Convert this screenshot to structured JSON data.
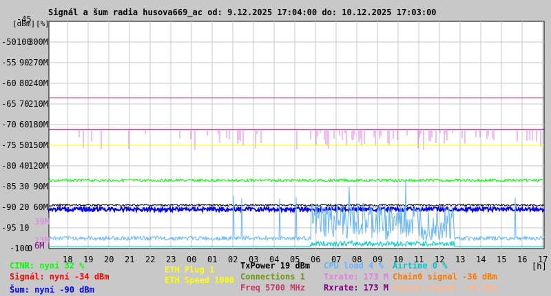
{
  "chart_data": {
    "type": "line",
    "title": "Signál a šum radia husova669_ac od: 9.12.2025 17:04:00 do: 10.12.2025 17:03:00",
    "ylabel_units": [
      "[dBm]",
      "[%]"
    ],
    "xlabel": "[h]",
    "x_ticks": [
      "18",
      "19",
      "20",
      "21",
      "22",
      "23",
      "00",
      "01",
      "02",
      "03",
      "04",
      "05",
      "06",
      "07",
      "08",
      "09",
      "10",
      "11",
      "12",
      "13",
      "14",
      "15",
      "16",
      "17"
    ],
    "y_ticks_dbm": [
      "-45",
      "-50",
      "-55",
      "-60",
      "-65",
      "-70",
      "-75",
      "-80",
      "-85",
      "-90",
      "-95",
      "-100"
    ],
    "y_ticks_pct": [
      "",
      "100",
      "90",
      "80",
      "70",
      "60",
      "50",
      "40",
      "30",
      "20",
      "10",
      "0"
    ],
    "y_ticks_rate": [
      "",
      "300M",
      "270M",
      "240M",
      "210M",
      "180M",
      "150M",
      "120M",
      "90M",
      "60M",
      "",
      ""
    ],
    "extra_rate_labels": [
      {
        "text": "39M",
        "color": "#e080e0"
      },
      {
        "text": "13M",
        "color": "#e080e0"
      },
      {
        "text": "6M",
        "color": "#800080"
      }
    ],
    "ylim_dbm": [
      -100,
      -45
    ],
    "grid": true,
    "series": [
      {
        "name": "Freq",
        "color": "#c83c64",
        "level_dbm": -63.5
      },
      {
        "name": "Rxrate",
        "color": "#800080",
        "level_dbm": -71.2
      },
      {
        "name": "Txrate",
        "color": "#e080e0",
        "level_dbm": -71.2
      },
      {
        "name": "ETH Speed",
        "color": "#ffff00",
        "level_dbm": -75
      },
      {
        "name": "CINR",
        "color": "#00ff00",
        "level_dbm": -83.5
      },
      {
        "name": "TxPower",
        "color": "#000000",
        "level_dbm": -89.5
      },
      {
        "name": "Šum",
        "color": "#0000ff",
        "level_dbm": -90.5
      },
      {
        "name": "CPU load",
        "color": "#64b4ff",
        "level_dbm": -98
      },
      {
        "name": "Airtime",
        "color": "#00c8c8",
        "level_dbm": -99.5
      }
    ]
  },
  "legend": {
    "cinr": "CINR: nyní 32 %",
    "signal": "Signál: nyní -34 dBm",
    "noise": "Šum: nyní -90 dBm",
    "eth_plug": "ETH Plug 1",
    "eth_speed": "ETH Speed 1000",
    "txpower": "TxPower 19 dBm",
    "connections": "Connections 1",
    "freq": "Freq 5700 MHz",
    "cpu": "CPU load 4 %",
    "txrate": "Txrate: 173 M",
    "rxrate": "Rxrate: 173 M",
    "airtime": "Airtime 0 %",
    "chain0": "Chain0 signal -36 dBm",
    "chain1": "Chain1 signal -38 dBm"
  },
  "colors": {
    "cinr": "#00ff00",
    "signal": "#ff0000",
    "noise": "#0000ff",
    "eth": "#ffff00",
    "txpower": "#000000",
    "connections": "#6e9614",
    "freq": "#c83c64",
    "cpu": "#64b4ff",
    "txrate": "#e080e0",
    "rxrate": "#800080",
    "airtime": "#00c8c8",
    "chain0": "#ff7800",
    "chain1": "#ffb48c"
  }
}
